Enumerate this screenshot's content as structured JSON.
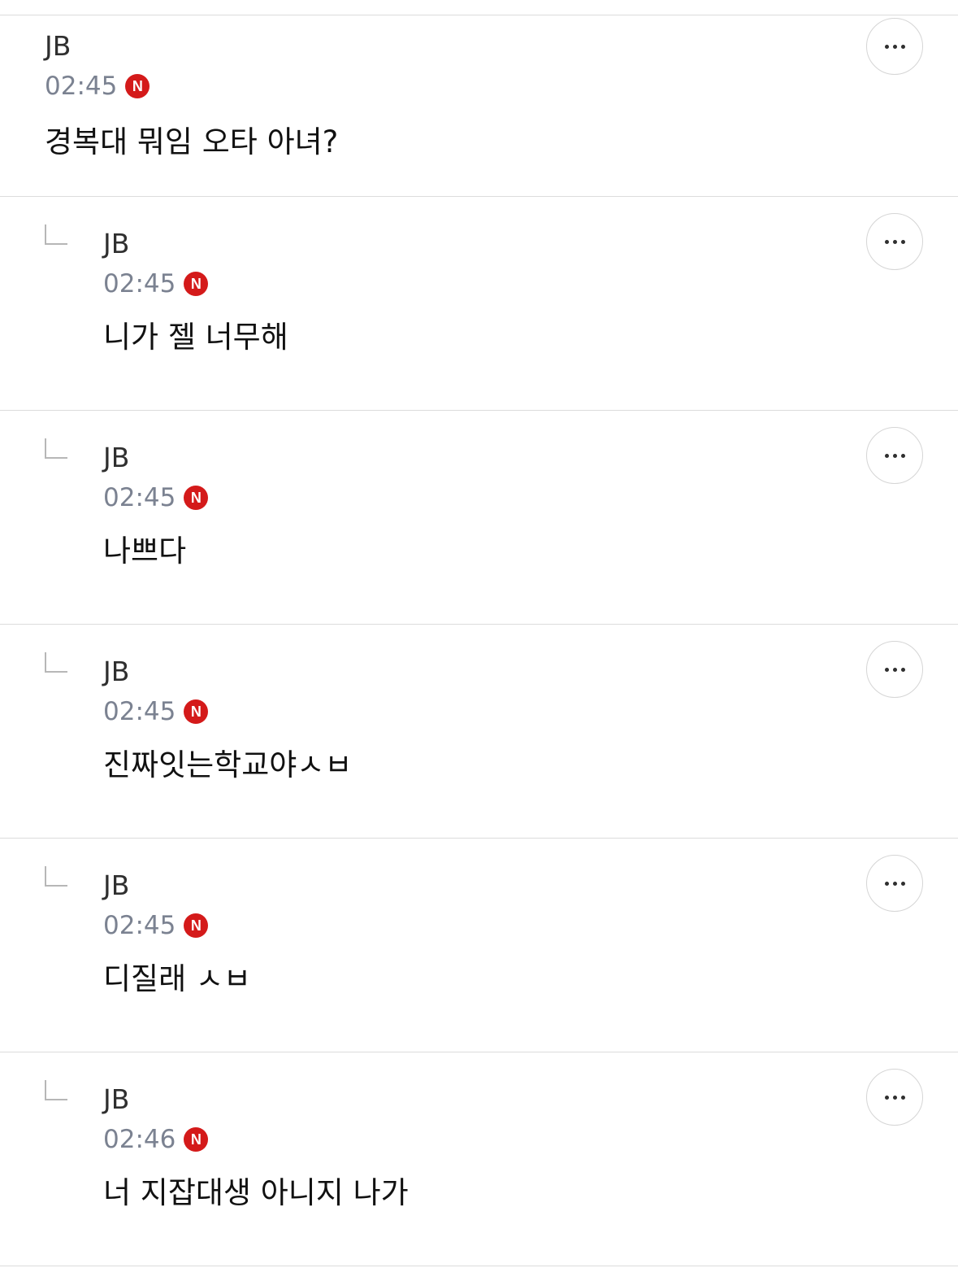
{
  "comments": [
    {
      "author": "JB",
      "time": "02:45",
      "badge": "N",
      "text": "경복대 뭐임 오타 아녀?",
      "is_reply": false
    },
    {
      "author": "JB",
      "time": "02:45",
      "badge": "N",
      "text": "니가 젤 너무해",
      "is_reply": true
    },
    {
      "author": "JB",
      "time": "02:45",
      "badge": "N",
      "text": "나쁘다",
      "is_reply": true
    },
    {
      "author": "JB",
      "time": "02:45",
      "badge": "N",
      "text": "진짜잇는학교야ㅅㅂ",
      "is_reply": true
    },
    {
      "author": "JB",
      "time": "02:45",
      "badge": "N",
      "text": "디질래 ㅅㅂ",
      "is_reply": true
    },
    {
      "author": "JB",
      "time": "02:46",
      "badge": "N",
      "text": "너 지잡대생 아니지 나가",
      "is_reply": true
    }
  ],
  "icons": {
    "more": "more-horizontal-icon",
    "reply": "reply-corner-icon",
    "new": "new-badge-icon"
  },
  "colors": {
    "badge": "#d41a1a",
    "time": "#7b8291",
    "divider": "#dcdcdc",
    "text": "#111111"
  }
}
